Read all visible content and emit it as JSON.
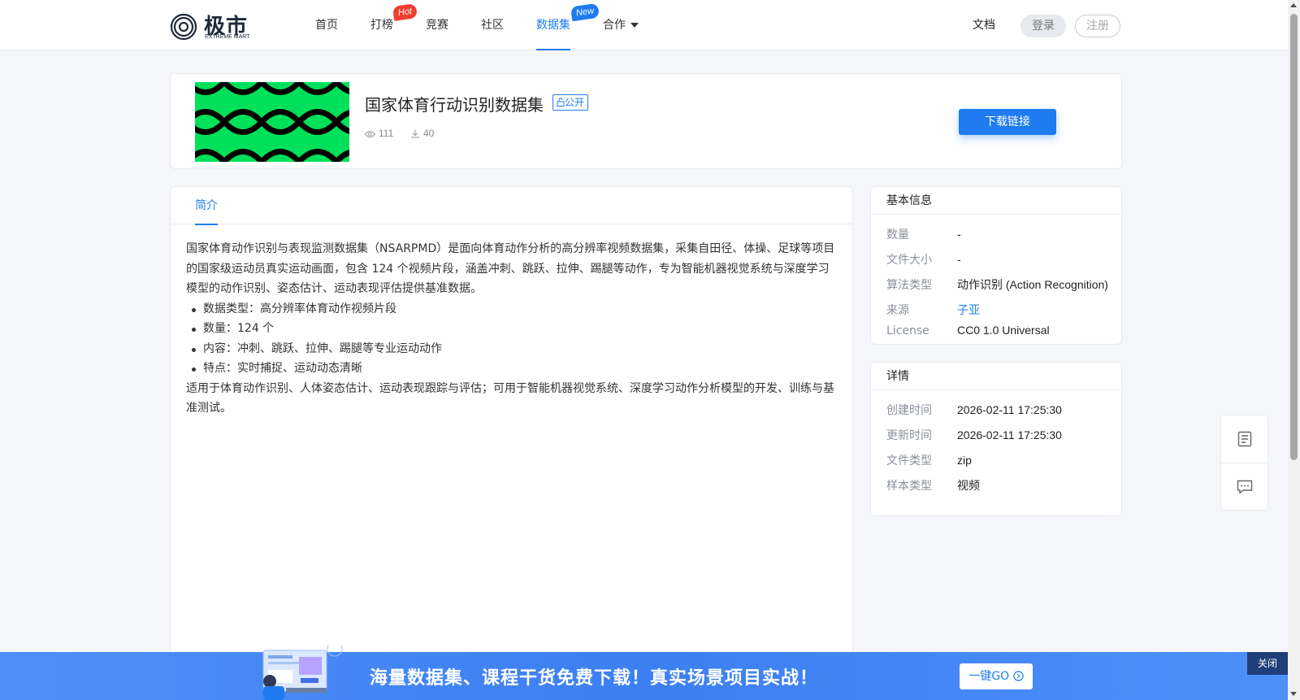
{
  "header": {
    "logo_title": "极市",
    "logo_subtitle": "EXTREME MART",
    "nav": [
      {
        "label": "首页"
      },
      {
        "label": "打榜",
        "badge": "Hot"
      },
      {
        "label": "竞赛"
      },
      {
        "label": "社区"
      },
      {
        "label": "数据集",
        "badge": "New",
        "active": true
      },
      {
        "label": "合作"
      }
    ],
    "docs": "文档",
    "login": "登录",
    "register": "注册"
  },
  "dataset": {
    "title": "国家体育行动识别数据集",
    "visibility": "公开",
    "views": "111",
    "downloads": "40",
    "download_button": "下载链接",
    "cover_colors": {
      "background": "#00e05a",
      "pattern": "#000000"
    }
  },
  "tabs": {
    "intro": "简介"
  },
  "intro": {
    "paragraph1": "国家体育动作识别与表现监测数据集（NSARPMD）是面向体育动作分析的高分辨率视频数据集，采集自田径、体操、足球等项目的国家级运动员真实运动画面，包含 124 个视频片段，涵盖冲刺、跳跃、拉伸、踢腿等动作，专为智能机器视觉系统与深度学习模型的动作识别、姿态估计、运动表现评估提供基准数据。",
    "bullets": [
      "数据类型：高分辨率体育动作视频片段",
      "数量：124 个",
      "内容：冲刺、跳跃、拉伸、踢腿等专业运动动作",
      "特点：实时捕捉、运动动态清晰"
    ],
    "paragraph2": "适用于体育动作识别、人体姿态估计、运动表现跟踪与评估；可用于智能机器视觉系统、深度学习动作分析模型的开发、训练与基准测试。"
  },
  "basic_info": {
    "heading": "基本信息",
    "rows": [
      {
        "key": "数量",
        "value": "-"
      },
      {
        "key": "文件大小",
        "value": "-"
      },
      {
        "key": "算法类型",
        "value": "动作识别 (Action Recognition)"
      },
      {
        "key": "来源",
        "value": "子亚"
      },
      {
        "key": "License",
        "value": "CC0 1.0 Universal"
      }
    ]
  },
  "details": {
    "heading": "详情",
    "rows": [
      {
        "key": "创建时间",
        "value": "2026-02-11 17:25:30"
      },
      {
        "key": "更新时间",
        "value": "2026-02-11 17:25:30"
      },
      {
        "key": "文件类型",
        "value": "zip"
      },
      {
        "key": "样本类型",
        "value": "视频"
      }
    ]
  },
  "float_tools": {
    "icons": [
      "document-icon",
      "feedback-icon"
    ]
  },
  "banner": {
    "text": "海量数据集、课程干货免费下载！真实场景项目实战！",
    "go_button": "一键GO",
    "close": "关闭"
  },
  "colors": {
    "accent": "#1f7cf0",
    "hot_badge": "#f23d2f",
    "banner": "#3c7ff2"
  }
}
